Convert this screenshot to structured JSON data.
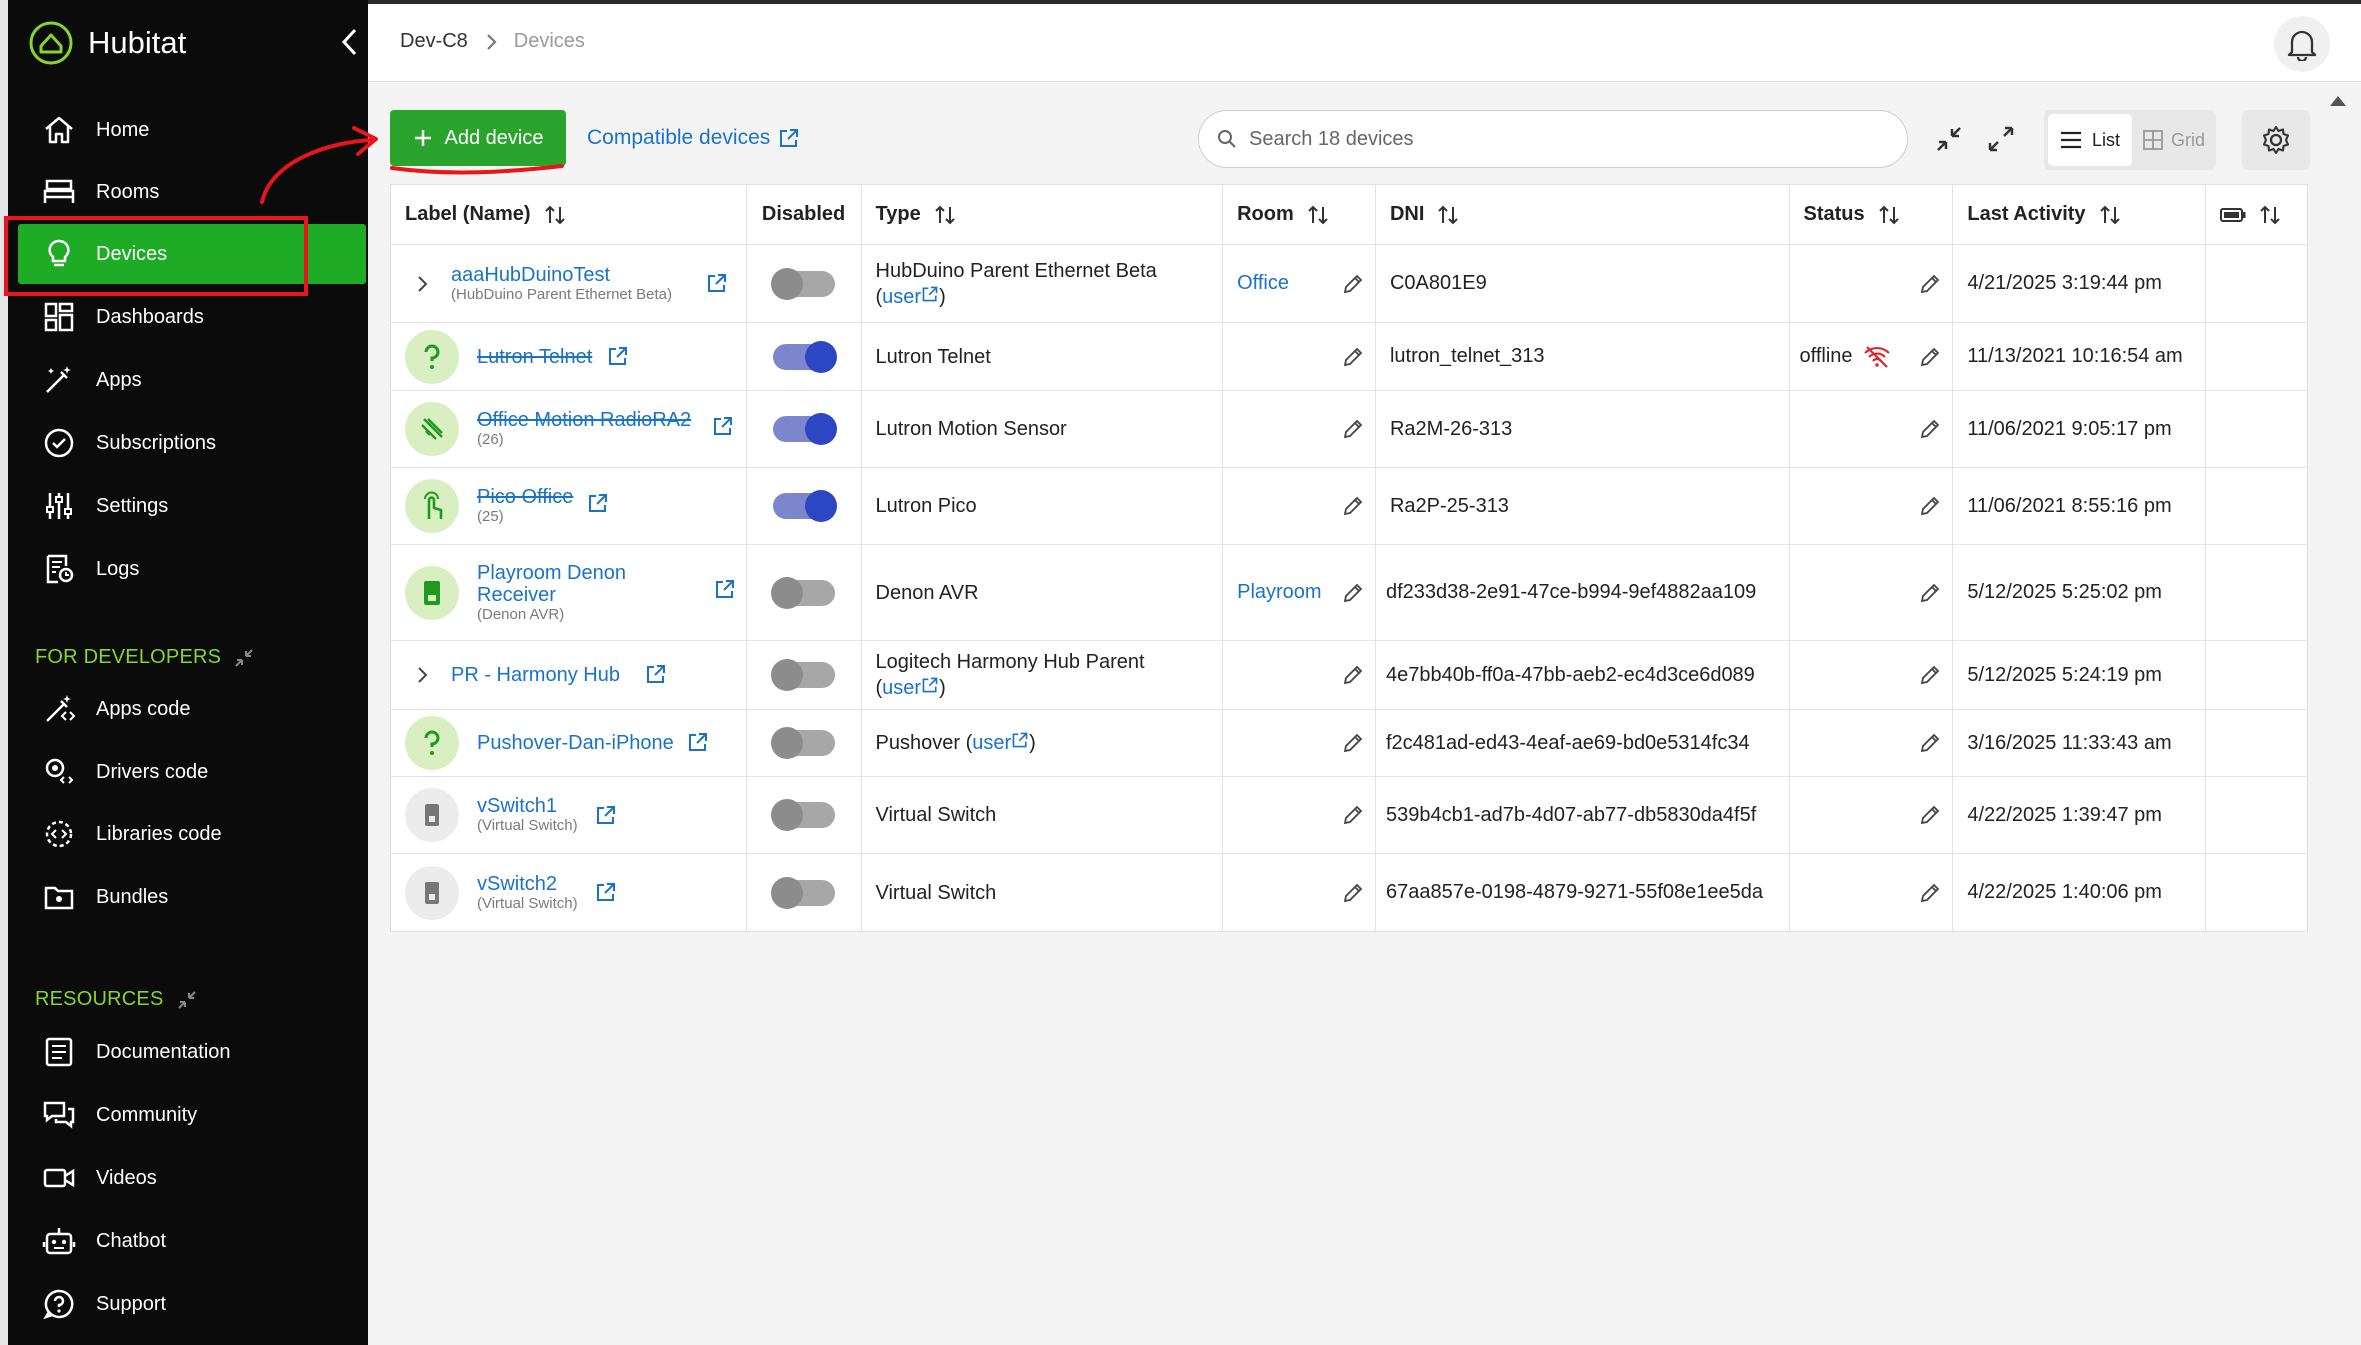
{
  "app": {
    "name": "Hubitat"
  },
  "sidebar": {
    "items": [
      {
        "label": "Home",
        "icon": "home-icon"
      },
      {
        "label": "Rooms",
        "icon": "rooms-icon"
      },
      {
        "label": "Devices",
        "icon": "lightbulb-icon",
        "active": true
      },
      {
        "label": "Dashboards",
        "icon": "dashboard-icon"
      },
      {
        "label": "Apps",
        "icon": "magic-wand-icon"
      },
      {
        "label": "Subscriptions",
        "icon": "check-circle-icon"
      },
      {
        "label": "Settings",
        "icon": "sliders-icon"
      },
      {
        "label": "Logs",
        "icon": "logs-icon"
      }
    ],
    "developers_label": "FOR DEVELOPERS",
    "developer_items": [
      {
        "label": "Apps code",
        "icon": "apps-code-icon"
      },
      {
        "label": "Drivers code",
        "icon": "drivers-code-icon"
      },
      {
        "label": "Libraries code",
        "icon": "libraries-code-icon"
      },
      {
        "label": "Bundles",
        "icon": "bundles-icon"
      }
    ],
    "resources_label": "RESOURCES",
    "resource_items": [
      {
        "label": "Documentation",
        "icon": "documentation-icon"
      },
      {
        "label": "Community",
        "icon": "community-icon"
      },
      {
        "label": "Videos",
        "icon": "video-icon"
      },
      {
        "label": "Chatbot",
        "icon": "robot-icon"
      },
      {
        "label": "Support",
        "icon": "help-icon"
      }
    ]
  },
  "header": {
    "hub": "Dev-C8",
    "page": "Devices"
  },
  "toolbar": {
    "add_label": "Add device",
    "compatible_label": "Compatible devices",
    "search_placeholder": "Search 18 devices",
    "list_label": "List",
    "grid_label": "Grid"
  },
  "table": {
    "columns": [
      "Label (Name)",
      "Disabled",
      "Type",
      "Room",
      "DNI",
      "Status",
      "Last Activity"
    ],
    "rows": [
      {
        "label": "aaaHubDuinoTest",
        "sub": "(HubDuino Parent Ethernet Beta)",
        "type": "HubDuino Parent Ethernet Beta",
        "user": true,
        "room": "Office",
        "dni": "C0A801E9",
        "status": "",
        "last": "4/21/2025 3:19:44 pm",
        "disabled": false,
        "strike": false
      },
      {
        "label": "Lutron Telnet",
        "sub": "",
        "type": "Lutron Telnet",
        "room": "",
        "dni": "lutron_telnet_313",
        "status": "offline",
        "last": "11/13/2021 10:16:54 am",
        "disabled": true,
        "strike": true
      },
      {
        "label": "Office Motion RadioRA2",
        "sub": "(26)",
        "type": "Lutron Motion Sensor",
        "room": "",
        "dni": "Ra2M-26-313",
        "status": "",
        "last": "11/06/2021 9:05:17 pm",
        "disabled": true,
        "strike": true
      },
      {
        "label": "Pico Office",
        "sub": "(25)",
        "type": "Lutron Pico",
        "room": "",
        "dni": "Ra2P-25-313",
        "status": "",
        "last": "11/06/2021 8:55:16 pm",
        "disabled": true,
        "strike": true
      },
      {
        "label": "Playroom Denon Receiver",
        "sub": "(Denon AVR)",
        "type": "Denon AVR",
        "room": "Playroom",
        "dni": "df233d38-2e91-47ce-b994-9ef4882aa109",
        "status": "",
        "last": "5/12/2025 5:25:02 pm",
        "disabled": false,
        "strike": false
      },
      {
        "label": "PR - Harmony Hub",
        "sub": "",
        "type": "Logitech Harmony Hub Parent",
        "user": true,
        "room": "",
        "dni": "4e7bb40b-ff0a-47bb-aeb2-ec4d3ce6d089",
        "status": "",
        "last": "5/12/2025 5:24:19 pm",
        "disabled": false,
        "strike": false
      },
      {
        "label": "Pushover-Dan-iPhone",
        "sub": "",
        "type": "Pushover",
        "user": true,
        "room": "",
        "dni": "f2c481ad-ed43-4eaf-ae69-bd0e5314fc34",
        "status": "",
        "last": "3/16/2025 11:33:43 am",
        "disabled": false,
        "strike": false
      },
      {
        "label": "vSwitch1",
        "sub": "(Virtual Switch)",
        "type": "Virtual Switch",
        "room": "",
        "dni": "539b4cb1-ad7b-4d07-ab77-db5830da4f5f",
        "status": "",
        "last": "4/22/2025 1:39:47 pm",
        "disabled": false,
        "strike": false
      },
      {
        "label": "vSwitch2",
        "sub": "(Virtual Switch)",
        "type": "Virtual Switch",
        "room": "",
        "dni": "67aa857e-0198-4879-9271-55f08e1ee5da",
        "status": "",
        "last": "4/22/2025 1:40:06 pm",
        "disabled": false,
        "strike": false
      }
    ],
    "user_label": "user"
  },
  "colors": {
    "brand_green": "#2aa42c",
    "link_blue": "#1a73c7",
    "annotation_red": "#e8151b",
    "sidebar_bg": "#0b0b0b"
  }
}
